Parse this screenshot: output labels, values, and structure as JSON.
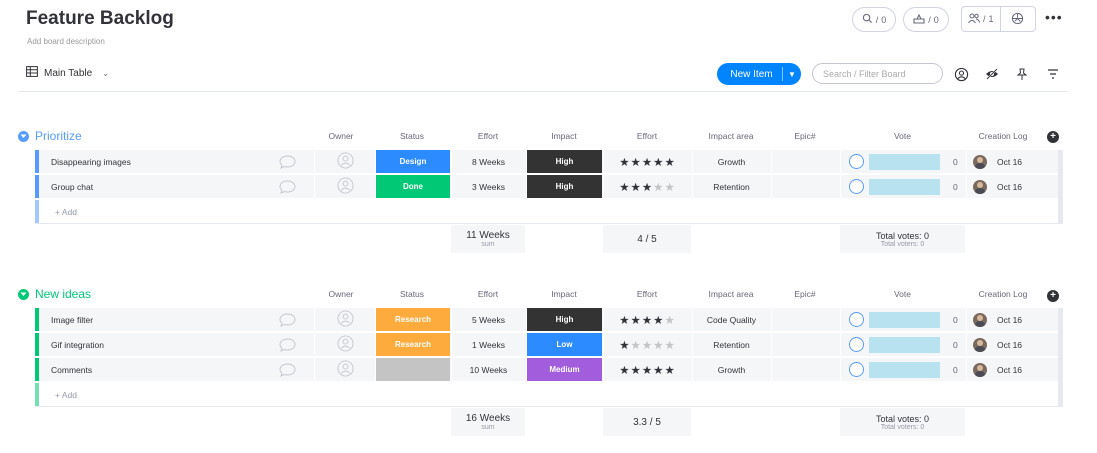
{
  "header": {
    "title": "Feature Backlog",
    "description": "Add board description",
    "activity_count": "0",
    "integrations_count": "0",
    "members_count": "1",
    "more": "•••"
  },
  "toolbar": {
    "view_label": "Main Table",
    "new_item_label": "New Item",
    "search_placeholder": "Search / Filter Board"
  },
  "columns": [
    "Owner",
    "Status",
    "Effort",
    "Impact",
    "Effort",
    "Impact area",
    "Epic#",
    "Vote",
    "Creation Log"
  ],
  "colors": {
    "accent": "#0085ff",
    "group_prioritize": "#579bfc",
    "group_new_ideas": "#00c875",
    "status_design": "#2b8bff",
    "status_done": "#00c875",
    "status_research": "#fdab3d",
    "status_empty": "#c4c4c4",
    "impact_high": "#333333",
    "impact_low": "#2b8bff",
    "impact_medium": "#a25ddc"
  },
  "add_label": "+ Add",
  "groups": [
    {
      "name": "Prioritize",
      "color": "#579bfc",
      "rows": [
        {
          "name": "Disappearing images",
          "status": "Design",
          "status_color": "#2b8bff",
          "effort": "8 Weeks",
          "impact": "High",
          "impact_color": "#333333",
          "rating": 5,
          "area": "Growth",
          "epic": "",
          "votes": "0",
          "log": "Oct 16"
        },
        {
          "name": "Group chat",
          "status": "Done",
          "status_color": "#00c875",
          "effort": "3 Weeks",
          "impact": "High",
          "impact_color": "#333333",
          "rating": 3,
          "area": "Retention",
          "epic": "",
          "votes": "0",
          "log": "Oct 16"
        }
      ],
      "summary": {
        "effort": "11 Weeks",
        "effort_sub": "sum",
        "rating": "4 / 5",
        "votes": "Total votes: 0",
        "voters": "Total voters: 0"
      }
    },
    {
      "name": "New ideas",
      "color": "#00c875",
      "rows": [
        {
          "name": "Image filter",
          "status": "Research",
          "status_color": "#fdab3d",
          "effort": "5 Weeks",
          "impact": "High",
          "impact_color": "#333333",
          "rating": 4,
          "area": "Code Quality",
          "epic": "",
          "votes": "0",
          "log": "Oct 16"
        },
        {
          "name": "Gif integration",
          "status": "Research",
          "status_color": "#fdab3d",
          "effort": "1 Weeks",
          "impact": "Low",
          "impact_color": "#2b8bff",
          "rating": 1,
          "area": "Retention",
          "epic": "",
          "votes": "0",
          "log": "Oct 16"
        },
        {
          "name": "Comments",
          "status": "",
          "status_color": "#c4c4c4",
          "effort": "10 Weeks",
          "impact": "Medium",
          "impact_color": "#a25ddc",
          "rating": 5,
          "area": "Growth",
          "epic": "",
          "votes": "0",
          "log": "Oct 16"
        }
      ],
      "summary": {
        "effort": "16 Weeks",
        "effort_sub": "sum",
        "rating": "3.3 / 5",
        "votes": "Total votes: 0",
        "voters": "Total voters: 0"
      }
    }
  ]
}
